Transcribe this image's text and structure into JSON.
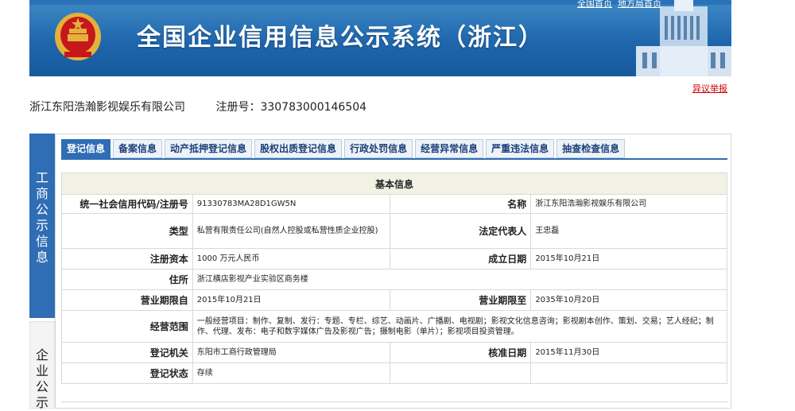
{
  "header": {
    "title": "全国企业信用信息公示系统（浙江）",
    "top_links": [
      "全国首页",
      "地方局首页"
    ],
    "report_link": "异议举报"
  },
  "company": {
    "name": "浙江东阳浩瀚影视娱乐有限公司",
    "reg_label": "注册号：",
    "reg_no": "330783000146504"
  },
  "side_nav": {
    "section1": [
      "工",
      "商",
      "公",
      "示",
      "信",
      "息"
    ],
    "section2": [
      "企",
      "业",
      "公",
      "示"
    ]
  },
  "tabs": [
    "登记信息",
    "备案信息",
    "动产抵押登记信息",
    "股权出质登记信息",
    "行政处罚信息",
    "经营异常信息",
    "严重违法信息",
    "抽查检查信息"
  ],
  "active_tab": 0,
  "table": {
    "heading": "基本信息",
    "rows": [
      {
        "l1": "统一社会信用代码/注册号",
        "v1": "91330783MA28D1GW5N",
        "l2": "名称",
        "v2": "浙江东阳浩瀚影视娱乐有限公司"
      },
      {
        "l1": "类型",
        "v1": "私营有限责任公司(自然人控股或私营性质企业控股)",
        "l2": "法定代表人",
        "v2": "王忠磊"
      },
      {
        "l1": "注册资本",
        "v1": "1000 万元人民币",
        "l2": "成立日期",
        "v2": "2015年10月21日"
      },
      {
        "l1": "住所",
        "v1": "浙江横店影视产业实验区商务楼"
      },
      {
        "l1": "营业期限自",
        "v1": "2015年10月21日",
        "l2": "营业期限至",
        "v2": "2035年10月20日"
      },
      {
        "l1": "经营范围",
        "v1": "一般经营项目：制作、复制、发行：专题、专栏、综艺、动画片、广播剧、电视剧；影视文化信息咨询；影视剧本创作、策划、交易；艺人经纪；制作、代理、发布：电子和数字媒体广告及影视广告；摄制电影（单片）；影视项目投资管理。"
      },
      {
        "l1": "登记机关",
        "v1": "东阳市工商行政管理局",
        "l2": "核准日期",
        "v2": "2015年11月30日"
      },
      {
        "l1": "登记状态",
        "v1": "存续",
        "l2": "",
        "v2": ""
      }
    ]
  },
  "colors": {
    "banner_blue": "#1f66ad",
    "tab_active": "#2f6db5",
    "table_header_bg": "#f2f2e4",
    "link_red": "#cc0000"
  }
}
